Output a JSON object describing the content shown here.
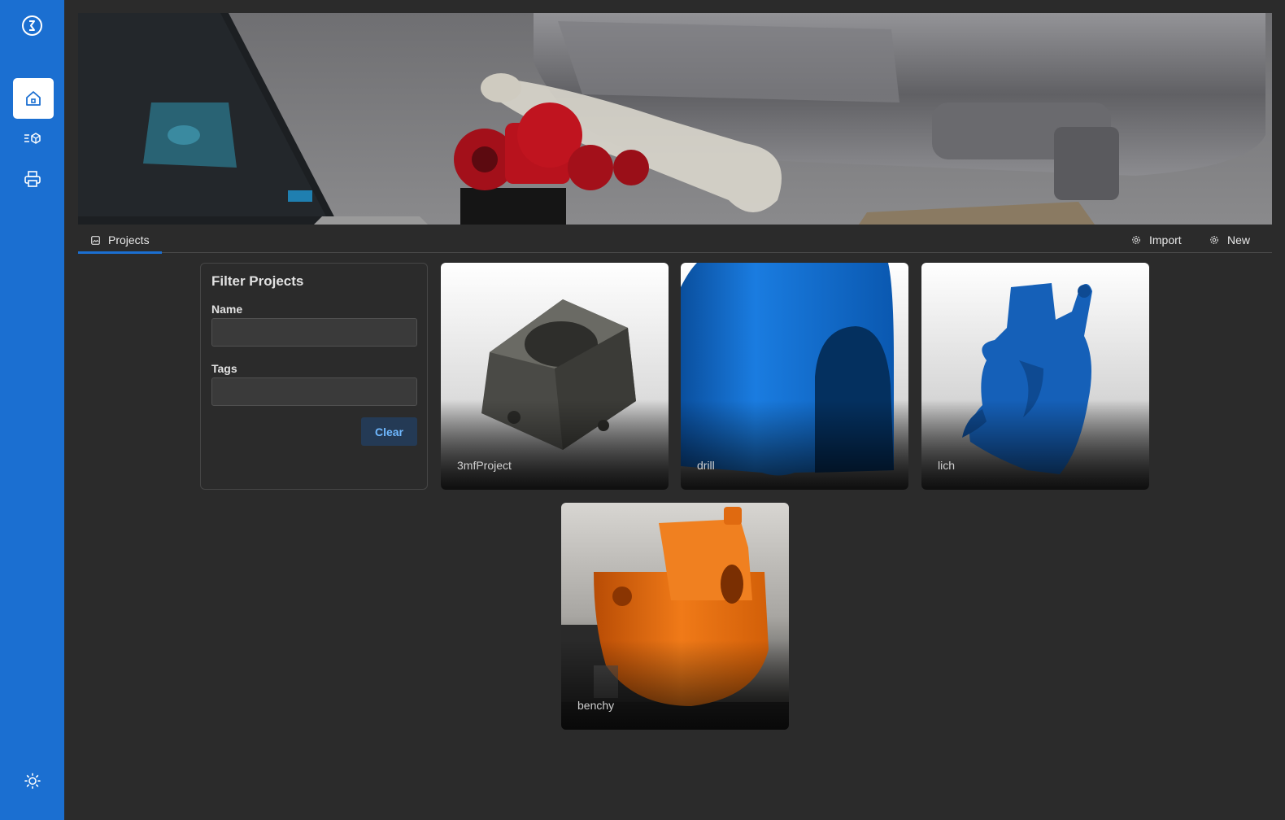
{
  "sidebar": {
    "items": [
      {
        "name": "logo",
        "icon": "logo-icon"
      },
      {
        "name": "home",
        "icon": "home-icon",
        "active": true
      },
      {
        "name": "models",
        "icon": "models-icon"
      },
      {
        "name": "printers",
        "icon": "printer-icon"
      },
      {
        "name": "theme",
        "icon": "sun-icon"
      }
    ]
  },
  "tabs": {
    "projects_label": "Projects"
  },
  "actions": {
    "import_label": "Import",
    "new_label": "New"
  },
  "filter": {
    "title": "Filter Projects",
    "name_label": "Name",
    "name_value": "",
    "tags_label": "Tags",
    "tags_value": "",
    "clear_label": "Clear"
  },
  "projects": [
    {
      "name": "3mfProject",
      "color": "#4a4a46"
    },
    {
      "name": "drill",
      "color": "#0b62c4"
    },
    {
      "name": "lich",
      "color": "#1560b8"
    },
    {
      "name": "benchy",
      "color": "#e86a10"
    }
  ],
  "colors": {
    "sidebar": "#1b6fd1",
    "background": "#2b2b2b",
    "accent": "#1b6fd1",
    "clear_text": "#6fb8ff"
  }
}
